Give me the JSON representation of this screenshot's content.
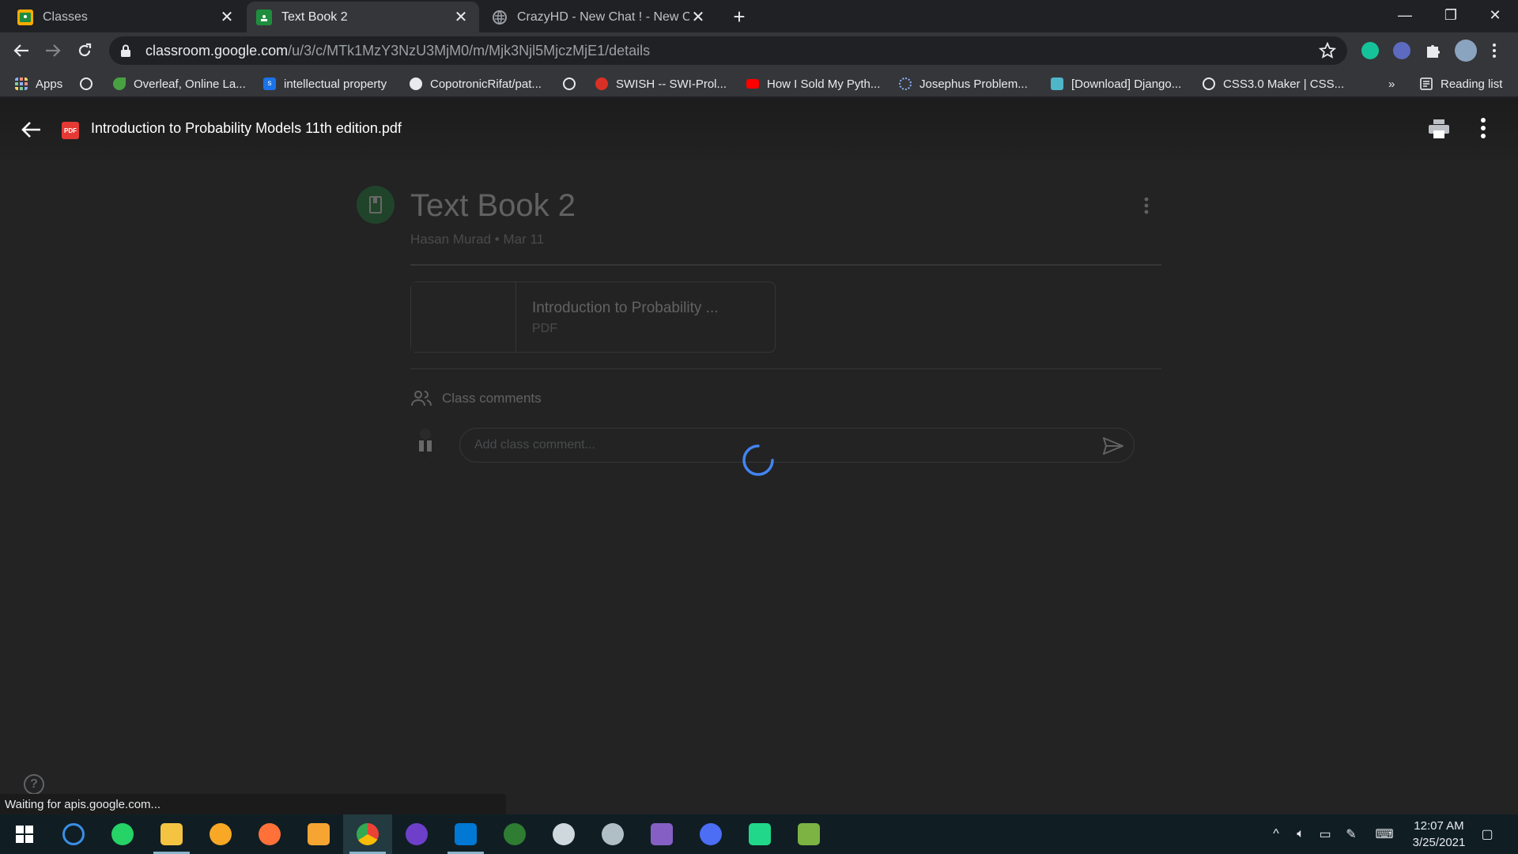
{
  "browser": {
    "tabs": [
      {
        "title": "Classes",
        "favicon": "classroom-icon",
        "active": false
      },
      {
        "title": "Text Book 2",
        "favicon": "classroom-icon",
        "active": true
      },
      {
        "title": "CrazyHD - New Chat ! - New Cha",
        "favicon": "globe-icon",
        "active": false
      }
    ],
    "url_host": "classroom.google.com",
    "url_path": "/u/3/c/MTk1MzY3NzU3MjM0/m/Mjk3Njl5MjczMjE1/details",
    "bookmarks": [
      {
        "label": "Apps",
        "icon": "apps-grid-icon"
      },
      {
        "label": "",
        "icon": "globe-icon"
      },
      {
        "label": "Overleaf, Online La...",
        "icon": "overleaf-icon"
      },
      {
        "label": "intellectual property",
        "icon": "scribd-icon"
      },
      {
        "label": "CopotronicRifat/pat...",
        "icon": "github-icon"
      },
      {
        "label": "",
        "icon": "globe-icon"
      },
      {
        "label": "SWISH -- SWI-Prol...",
        "icon": "swish-icon"
      },
      {
        "label": "How I Sold My Pyth...",
        "icon": "youtube-icon"
      },
      {
        "label": "Josephus Problem...",
        "icon": "loading-icon"
      },
      {
        "label": "[Download] Django...",
        "icon": "django-icon"
      },
      {
        "label": "CSS3.0 Maker | CSS...",
        "icon": "globe-icon"
      }
    ],
    "bookmarks_overflow": "»",
    "reading_list": "Reading list"
  },
  "viewer": {
    "file_title": "Introduction to Probability Models 11th edition.pdf",
    "badge": "PDF"
  },
  "assignment": {
    "title": "Text Book 2",
    "author": "Hasan Murad",
    "date": "Mar 11",
    "attachment_name": "Introduction to Probability ...",
    "attachment_type": "PDF",
    "comments_heading": "Class comments",
    "comment_placeholder": "Add class comment..."
  },
  "status_text": "Waiting for apis.google.com...",
  "help": "?",
  "taskbar": {
    "time": "12:07 AM",
    "date": "3/25/2021"
  },
  "colors": {
    "accent": "#1a73e8",
    "classroom_green": "#1e8e3e",
    "pdf_red": "#e53935"
  }
}
